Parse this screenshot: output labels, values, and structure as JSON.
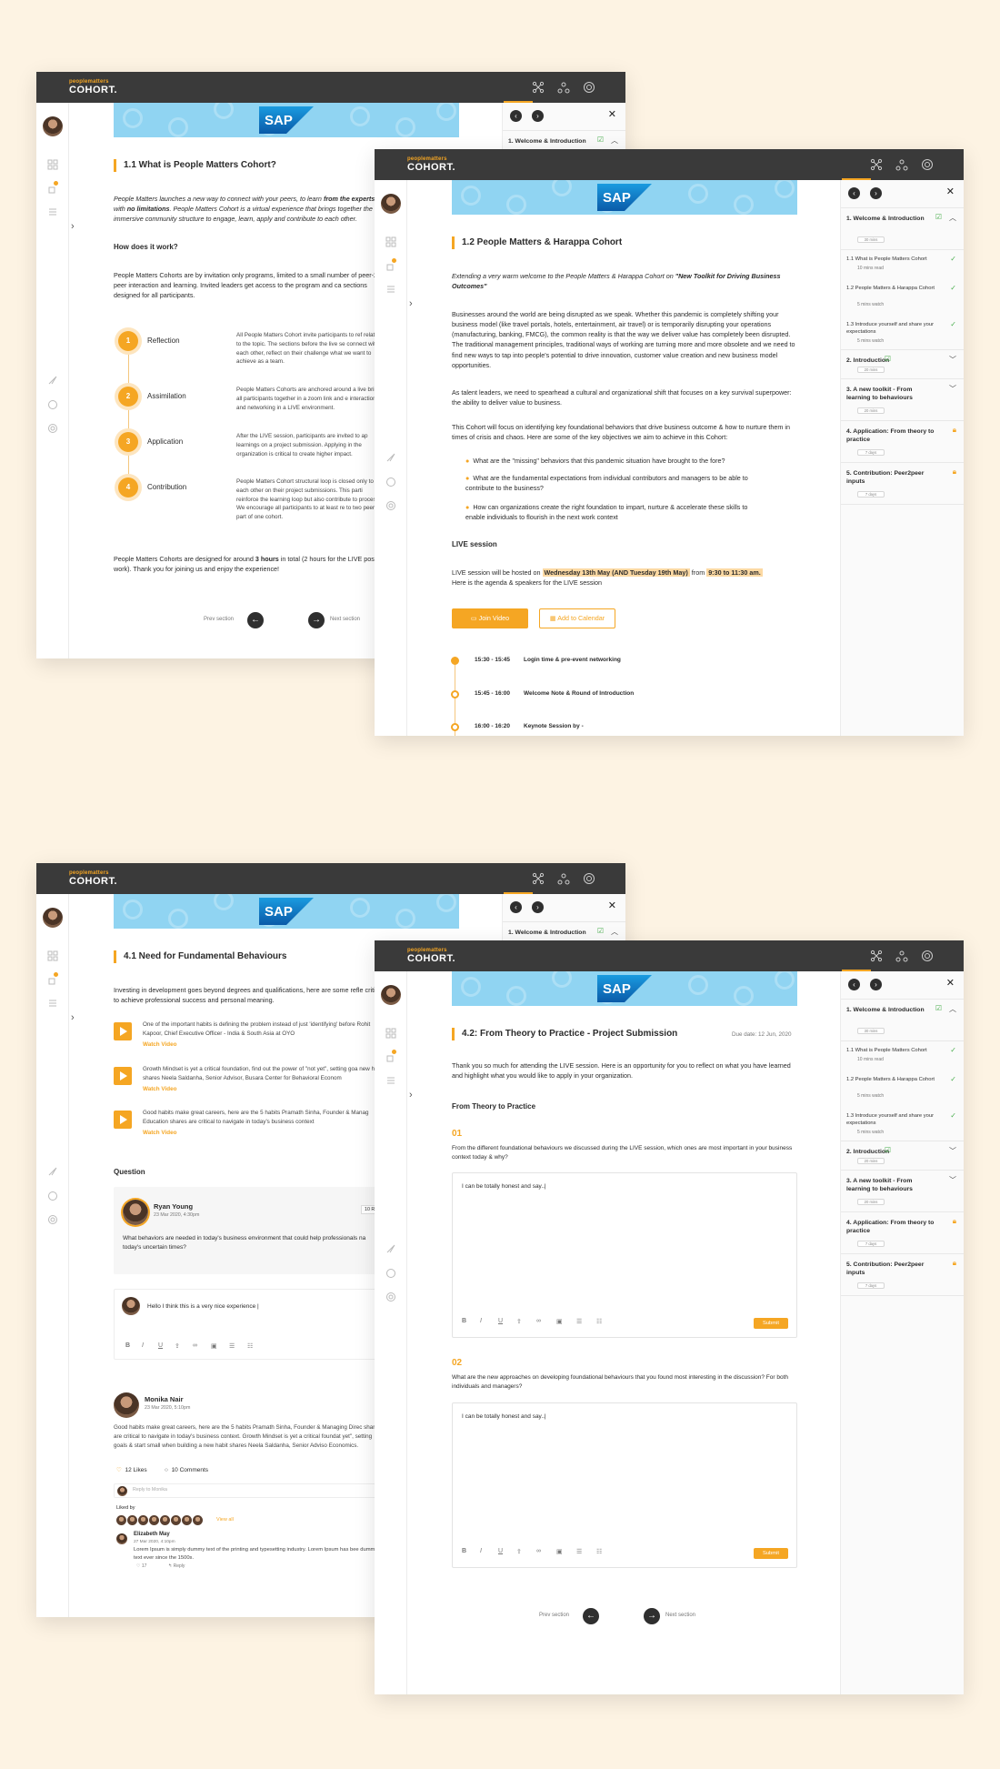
{
  "brand": {
    "top": "peoplematters",
    "name": "COHORT."
  },
  "panel": {
    "sections": [
      {
        "label": "1. Welcome & Introduction",
        "pill": "30 mins"
      },
      {
        "label": "2. Introduction",
        "pill": "20 mins"
      },
      {
        "label": "3. A new toolkit - From learning to behaviours",
        "pill": "20 mins"
      },
      {
        "label": "4. Application: From theory to practice",
        "pill": "7 days"
      },
      {
        "label": "5. Contribution: Peer2peer inputs",
        "pill": "7 days"
      }
    ],
    "items": [
      {
        "label": "1.1 What is People Matters Cohort",
        "meta": "10 mins read"
      },
      {
        "label": "1.2 People Matters & Harappa Cohort",
        "meta": "5 mins watch"
      },
      {
        "label": "1.3 Introduce yourself and share your expectations",
        "meta": "5 mins watch"
      }
    ]
  },
  "s1": {
    "title": "1.1 What is People Matters Cohort?",
    "intro_a": "People Matters launches a new way to connect with your peers, to learn ",
    "intro_b": "from the experts,",
    "intro_c": " with ",
    "intro_d": "no limitations",
    "intro_e": ". People Matters Cohort is a virtual experience that brings together the immersive community structure to engage, learn, apply and contribute to each other.",
    "how_heading": "How does it work?",
    "how_para": "People Matters Cohorts are by invitation only programs, limited to a small number of peer-2-peer interaction and learning. Invited leaders get access to the program and ca sections designed for all participants.",
    "steps": [
      {
        "num": "1",
        "label": "Reflection",
        "text": "All People Matters Cohort invite participants to ref related to the topic. The sections before the live se connect with each other, reflect on their challenge what we want to achieve as a team."
      },
      {
        "num": "2",
        "label": "Assimilation",
        "text": "People Matters Cohorts are anchored around a live bring all participants together in a zoom link and e interaction and networking in a LIVE environment."
      },
      {
        "num": "3",
        "label": "Application",
        "text": "After the LIVE session, participants are invited to ap learnings on a project submission. Applying in the organization is critical to create higher impact."
      },
      {
        "num": "4",
        "label": "Contribution",
        "text": "People Matters Cohort structural loop is closed only to each other on their project submissions. This parti reinforce the learning loop but also contribute to process. We encourage all participants to at least re to two peers as part of one cohort."
      }
    ],
    "closing_a": "People Matters Cohorts are designed for around ",
    "closing_b": "3 hours",
    "closing_c": " in total (2 hours for the LIVE post work). Thank you for joining us and enjoy the experience!",
    "prev": "Prev section",
    "next": "Next section"
  },
  "s2": {
    "title": "1.2 People Matters & Harappa Cohort",
    "intro_a": "Extending a very warm welcome to the People Matters & Harappa Cohort on ",
    "intro_b": "\"New Toolkit for Driving Business Outcomes\"",
    "p1": "Businesses around the world are being disrupted as we speak. Whether this pandemic is completely shifting your business model (like travel portals, hotels, entertainment, air travel) or is temporarily disrupting your operations (manufacturing, banking, FMCG), the common reality is that the way we deliver value has completely been disrupted. The traditional management principles, traditional ways of working are turning more and more obsolete and we need to find new ways to tap into people's potential to drive innovation, customer value creation and new business model opportunities.",
    "p2": "As talent leaders, we need to spearhead a cultural and organizational shift that focuses on a key survival superpower: the ability to deliver value to business.",
    "p3": "This Cohort will focus on identifying key foundational behaviors that drive business outcome & how to nurture them in times of crisis and chaos. Here are some of the key objectives we aim to achieve in this Cohort:",
    "bullets": [
      "What are the \"missing\" behaviors that this pandemic situation have brought to the fore?",
      "What are the fundamental expectations from individual contributors and managers to be able to contribute to the business?",
      "How can organizations create the right foundation to impart, nurture & accelerate these skills to enable individuals to flourish in the next work context"
    ],
    "live_heading": "LIVE session",
    "live_a": "LIVE session will be hosted on ",
    "live_b": "Wednesday 13th May (AND Tuesday 19th May)",
    "live_c": " from ",
    "live_d": "9:30 to 11:30 am.",
    "live_e": "Here is the agenda & speakers for the LIVE session",
    "join": "Join Video",
    "calendar": "Add to Calendar",
    "agenda": [
      {
        "time": "15:30 - 15:45",
        "title": "Login time & pre-event networking"
      },
      {
        "time": "15:45 - 16:00",
        "title": "Welcome Note & Round of Introduction"
      },
      {
        "time": "16:00 - 16:20",
        "title": "Keynote Session by -"
      }
    ]
  },
  "s3": {
    "title": "4.1  Need for Fundamental Behaviours",
    "intro": "Investing in development goes beyond degrees and qualifications, here are some refle critical to achieve professional success and personal meaning.",
    "videos": [
      {
        "text": "One of the important habits is defining the problem instead of just 'identifying' before Rohit Kapoor, Chief Executive Officer - India & South Asia at OYO",
        "link": "Watch Video"
      },
      {
        "text": "Growth Mindset is yet a critical foundation, find out the power of \"not yet\", setting goa new habit shares Neela Saldanha, Senior Advisor,  Busara Center for Behavioral Econom",
        "link": "Watch Video"
      },
      {
        "text": "Good habits make great careers, here are the 5 habits Pramath Sinha, Founder & Manag Education shares are critical to navigate in today's business context",
        "link": "Watch Video"
      }
    ],
    "question_heading": "Question",
    "asker": {
      "name": "Ryan Young",
      "date": "23 Mar 2020, 4:30pm",
      "badge": "10 Re"
    },
    "question": "What behaviors are needed in today's business environment that could help professionals na today's uncertain times?",
    "reply_text": "Hello I think this is a very nice experience |",
    "comment": {
      "name": "Monika Nair",
      "date": "23 Mar 2020, 5:10pm",
      "text": "Good habits make great careers, here are the 5 habits Pramath Sinha, Founder & Managing Direc shares are critical to navigate in today's business context. Growth Mindset is yet a critical foundat yet\", setting goals & start small when building a new habit shares Neela Saldanha, Senior Adviso Economics."
    },
    "likes": "12 Likes",
    "comments": "10 Comments",
    "reply_placeholder": "Reply to Monika",
    "liked_by": "Liked by",
    "view_all": "View all",
    "reply": {
      "name": "Elizabeth May",
      "date": "27 Mar 2020, 4:10pm",
      "text": "Lorem Ipsum is simply dummy text of the printing and typesetting industry. Lorem Ipsum has bee dummy text ever since the 1500s.",
      "likes": "17",
      "action": "Reply"
    }
  },
  "s4": {
    "title": "4.2: From Theory to Practice - Project Submission",
    "due": "Due date: 12 Jun, 2020",
    "intro": "Thank you so much for attending the LIVE session. Here is an opportunity for you  to reflect on what you have learned and highlight what you would like to apply in your organization.",
    "subheading": "From Theory to Practice",
    "questions": [
      {
        "num": "01",
        "text": "From the different foundational behaviours we discussed during the LIVE session, which ones are most important in your business context today & why?",
        "answer": "I can be totally honest and say..|"
      },
      {
        "num": "02",
        "text": "What are the new approaches on developing foundational behaviours that you found most interesting in the discussion? For both individuals and managers?",
        "answer": "I can be totally honest and say..|"
      }
    ],
    "submit": "Submit",
    "prev": "Prev section",
    "next": "Next section"
  },
  "colors": {
    "accent": "#f5a623",
    "topbar": "#3a3a3a",
    "banner": "#90d4f2",
    "check": "#4caf50"
  }
}
